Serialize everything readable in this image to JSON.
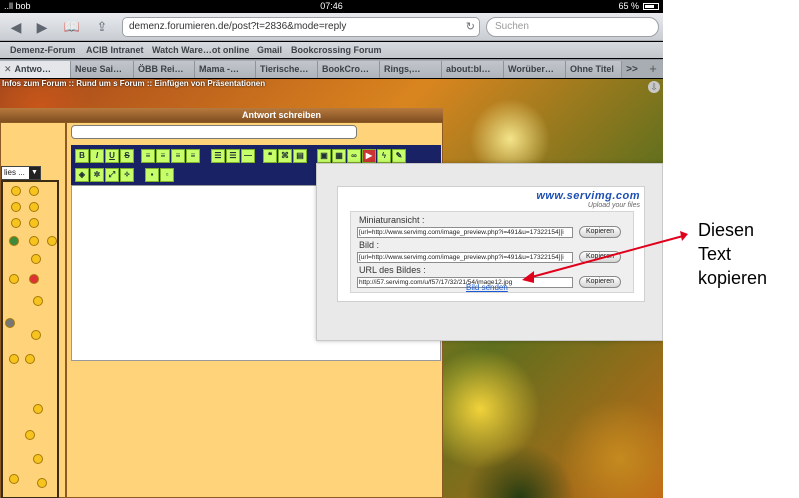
{
  "status_bar": {
    "carrier": "..ll bob",
    "time": "07:46",
    "battery": "65 %"
  },
  "toolbar": {
    "url": "demenz.forumieren.de/post?t=2836&mode=reply",
    "search_placeholder": "Suchen"
  },
  "bookmarks": [
    "Demenz-Forum",
    "ACIB Intranet",
    "Watch Ware…ot online",
    "Gmail",
    "Bookcrossing Forum"
  ],
  "tabs": [
    "Antwo…",
    "Neue Sai…",
    "ÖBB Rei…",
    "Mama -…",
    "Tierische…",
    "BookCro…",
    "Rings,…",
    "about:bl…",
    "Worüber…",
    "Ohne Titel"
  ],
  "tab_close": "✕",
  "tab_more": ">>",
  "tab_plus": "+",
  "page": {
    "breadcrumb": "Infos zum Forum :: Rund um  s Forum :: Einfügen von Präsentationen",
    "panel_title": "Antwort schreiben",
    "smiley_select": "lies ..."
  },
  "editor_buttons_row1": [
    "B",
    "I",
    "U",
    "S"
  ],
  "popup": {
    "logo": "www.servimg.com",
    "logo_sub": "Upload your files",
    "label_thumb": "Miniaturansicht :",
    "value_thumb": "[url=http://www.servimg.com/image_preview.php?i=491&u=17322154][i",
    "label_image": "Bild :",
    "value_image": "[url=http://www.servimg.com/image_preview.php?i=491&u=17322154][i",
    "label_url": "URL des Bildes :",
    "value_url": "http://i57.servimg.com/u/f57/17/32/21/54/image12.jpg",
    "copy_button": "Kopieren",
    "send_link": "Bild senden"
  },
  "annotation": {
    "line1": "Diesen",
    "line2": "Text",
    "line3": "kopieren",
    "arrow_color": "#e0001b"
  }
}
